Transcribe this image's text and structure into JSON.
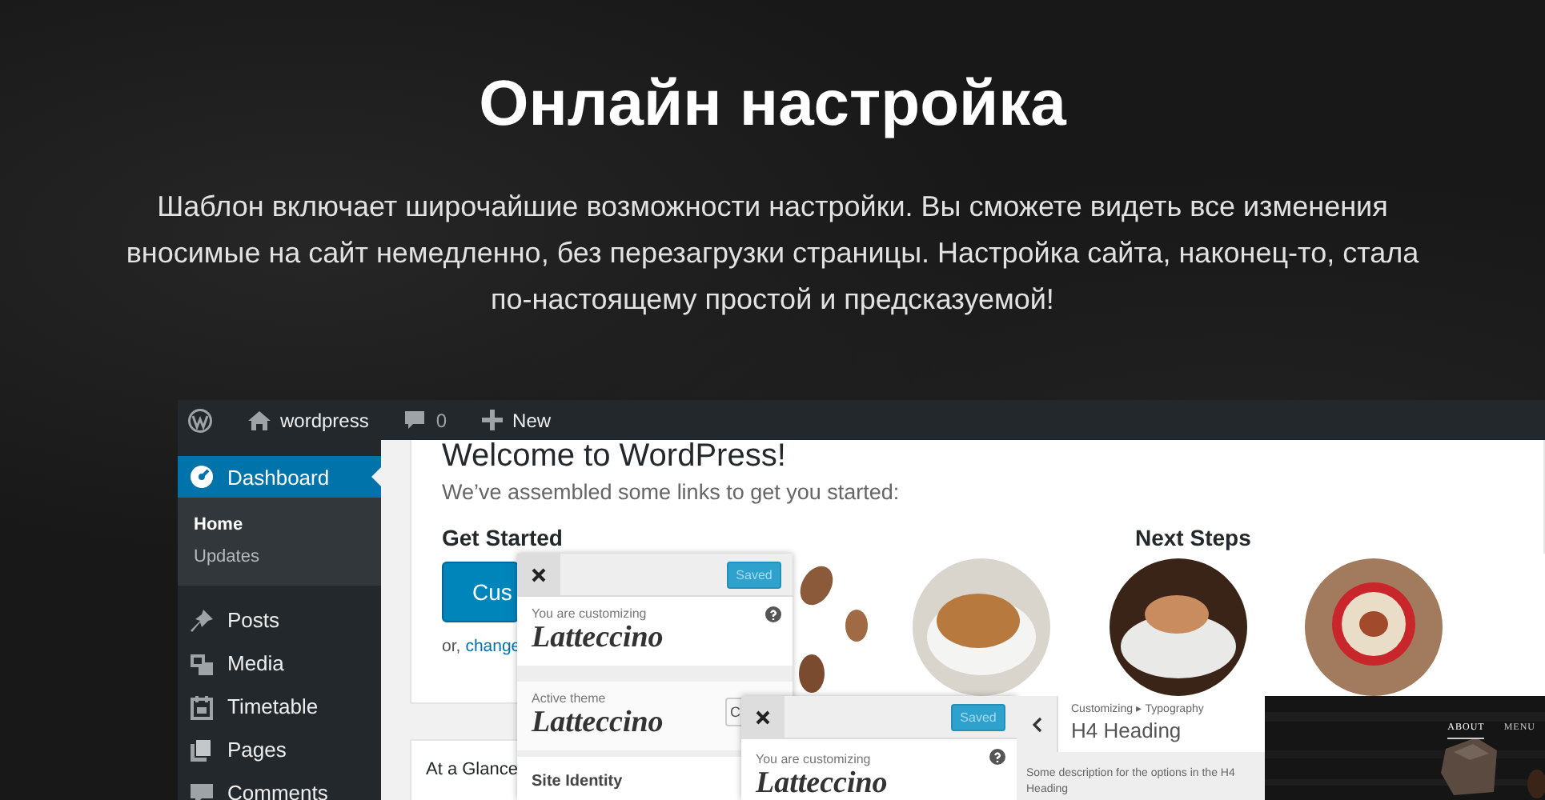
{
  "hero": {
    "title": "Онлайн настройка",
    "text": "Шаблон включает широчайшие возможности настройки. Вы сможете видеть все изменения\nвносимые на сайт немедленно, без перезагрузки страницы. Настройка сайта, наконец-то, стала\nпо-настоящему простой и предсказуемой!"
  },
  "admin_bar": {
    "site": "wordpress",
    "comments": "0",
    "new": "New"
  },
  "sidebar": {
    "items": [
      {
        "label": "Dashboard",
        "selected": true,
        "children": [
          {
            "label": "Home",
            "selected": true
          },
          {
            "label": "Updates",
            "selected": false
          }
        ]
      },
      {
        "label": "Posts",
        "selected": false
      },
      {
        "label": "Media",
        "selected": false
      },
      {
        "label": "Timetable",
        "selected": false
      },
      {
        "label": "Pages",
        "selected": false
      },
      {
        "label": "Comments",
        "selected": false
      }
    ]
  },
  "welcome": {
    "title": "Welcome to WordPress!",
    "subtitle": "We’ve assembled some links to get you started:",
    "get_started": "Get Started",
    "button": "Cus",
    "alt_prefix": "or,",
    "alt_link": "change",
    "next_steps": "Next Steps"
  },
  "glance": {
    "title": "At a Glance"
  },
  "customizer_main": {
    "save_button": "Saved",
    "label": "You are customizing",
    "theme": "Latteccino",
    "active_label": "Active theme",
    "active_theme": "Latteccino",
    "change_button": "C",
    "section": "Site Identity"
  },
  "customizer_second": {
    "save_button": "Saved",
    "label": "You are customizing",
    "theme": "Latteccino"
  },
  "typography_panel": {
    "breadcrumb": "Customizing ▸ Typography",
    "title": "H4 Heading",
    "description": "Some description for the options in the H4 Heading"
  },
  "site_preview": {
    "nav": [
      {
        "label": "ABOUT",
        "selected": true
      },
      {
        "label": "MENU",
        "selected": false
      }
    ]
  }
}
